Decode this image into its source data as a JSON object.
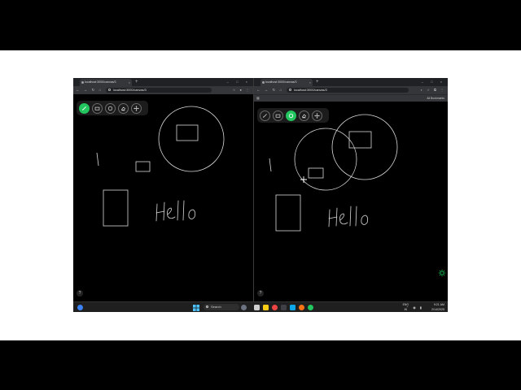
{
  "left_window": {
    "tab_title": "localhost:3000/canvas/3",
    "url": "localhost:3000/canvas/3",
    "tools": [
      {
        "name": "pencil-tool",
        "icon": "pencil-icon",
        "active": true
      },
      {
        "name": "rectangle-tool",
        "icon": "rectangle-icon",
        "active": false
      },
      {
        "name": "circle-tool",
        "icon": "circle-icon",
        "active": false
      },
      {
        "name": "eraser-tool",
        "icon": "eraser-icon",
        "active": false
      },
      {
        "name": "pan-tool",
        "icon": "move-icon",
        "active": false
      }
    ],
    "canvas_text": "Hello"
  },
  "right_window": {
    "tab_title": "localhost:3000/canvas/3",
    "url": "localhost:3000/canvas/3",
    "bookmarks_label": "All Bookmarks",
    "tools": [
      {
        "name": "pencil-tool",
        "icon": "pencil-icon",
        "active": false
      },
      {
        "name": "rectangle-tool",
        "icon": "rectangle-icon",
        "active": false
      },
      {
        "name": "circle-tool",
        "icon": "circle-icon",
        "active": true
      },
      {
        "name": "eraser-tool",
        "icon": "eraser-icon",
        "active": false
      },
      {
        "name": "pan-tool",
        "icon": "move-icon",
        "active": false
      }
    ],
    "canvas_text": "Hello"
  },
  "taskbar": {
    "search_placeholder": "Search",
    "lang_top": "ENG",
    "lang_bottom": "IN",
    "time": "9:21 AM",
    "date": "2/14/2025"
  },
  "colors": {
    "accent": "#22c55e",
    "canvas_bg": "#000000",
    "stroke": "#d9d9d9"
  }
}
